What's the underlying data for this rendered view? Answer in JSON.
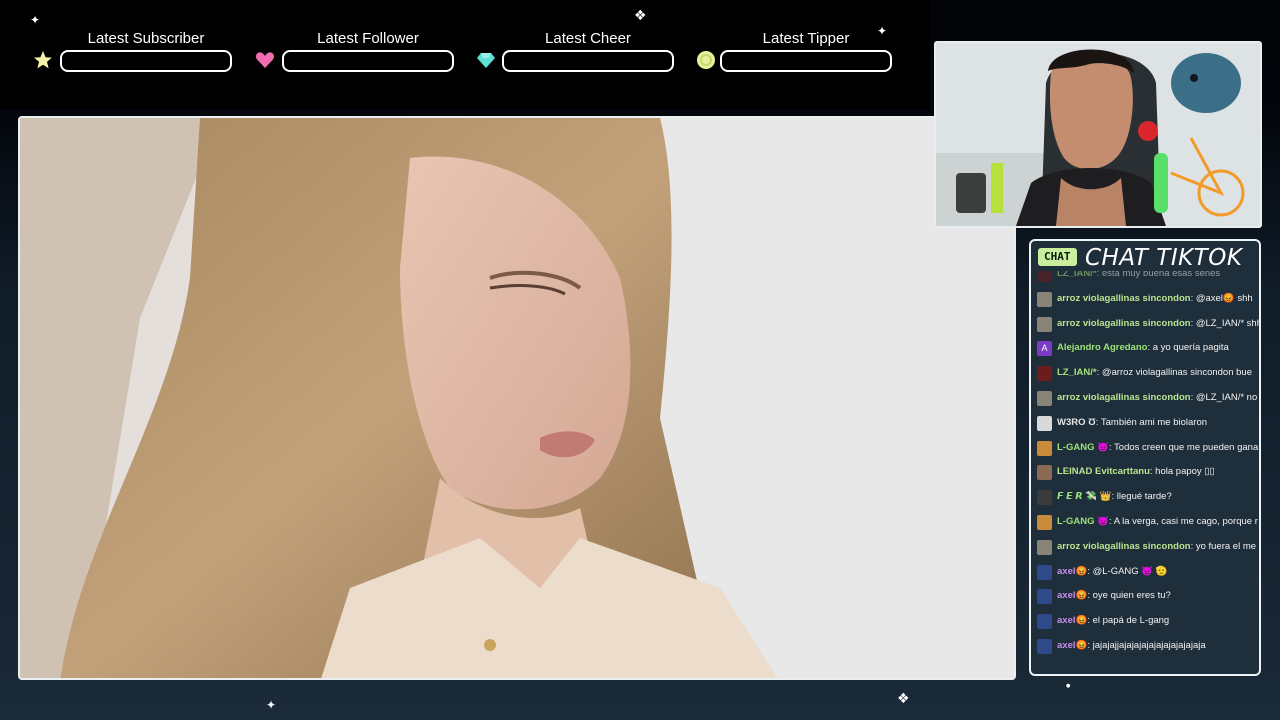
{
  "alerts": [
    {
      "label": "Latest Subscriber",
      "value": "",
      "icon": "star-icon",
      "color": "#f4f1a8"
    },
    {
      "label": "Latest Follower",
      "value": "",
      "icon": "heart-icon",
      "color": "#f06db0"
    },
    {
      "label": "Latest Cheer",
      "value": "",
      "icon": "gem-icon",
      "color": "#5fe0d6"
    },
    {
      "label": "Latest Tipper",
      "value": "",
      "icon": "coin-icon",
      "color": "#e8f19b"
    }
  ],
  "chat": {
    "badge": "CHAT",
    "title": "CHAT TIKTOK",
    "messages": [
      {
        "user": "LZ_IAN/*",
        "text": ": esta muy buena esas series",
        "user_color": "#a6e07a",
        "avatar": "red"
      },
      {
        "user": "arroz violagallinas sincondon",
        "text": ": @axel😡 shh",
        "user_color": "#b9e48f",
        "avatar": "grid"
      },
      {
        "user": "arroz violagallinas sincondon",
        "text": ": @LZ_IAN/* shh",
        "user_color": "#b9e48f",
        "avatar": "grid"
      },
      {
        "user": "Alejandro Agredano",
        "text": ": a yo quería pagita",
        "user_color": "#9be37a",
        "avatar": "letter-a"
      },
      {
        "user": "LZ_IAN/*",
        "text": ": @arroz violagallinas sincondon bue",
        "user_color": "#a6e07a",
        "avatar": "red"
      },
      {
        "user": "arroz violagallinas sincondon",
        "text": ": @LZ_IAN/* no p",
        "user_color": "#b9e48f",
        "avatar": "grid"
      },
      {
        "user": "W3RO Ʊ",
        "text": ": También ami me biolaron",
        "user_color": "#e6e6e6",
        "avatar": "white"
      },
      {
        "user": "L-GANG 😈",
        "text": ": Todos creen que me pueden gana",
        "user_color": "#9be37a",
        "avatar": "orange"
      },
      {
        "user": "LEINAD Evitcarttanu",
        "text": ": hola papoy ▯▯",
        "user_color": "#b9e48f",
        "avatar": "brown"
      },
      {
        "user": "𝙁 𝙀 𝙍 💸 👑",
        "text": ": llegué tarde?",
        "user_color": "#9be37a",
        "avatar": "dark"
      },
      {
        "user": "L-GANG 😈",
        "text": ": A la verga, casi me cago, porque r",
        "user_color": "#9be37a",
        "avatar": "orange"
      },
      {
        "user": "arroz violagallinas sincondon",
        "text": ": yo fuera el me l",
        "user_color": "#b9e48f",
        "avatar": "grid"
      },
      {
        "user": "axel😡",
        "text": ": @L-GANG 😈 🫡",
        "user_color": "#c98cf0",
        "avatar": "blue"
      },
      {
        "user": "axel😡",
        "text": ": oye quien eres tu?",
        "user_color": "#c98cf0",
        "avatar": "blue"
      },
      {
        "user": "axel😡",
        "text": ": el papá de L-gang",
        "user_color": "#c98cf0",
        "avatar": "blue"
      },
      {
        "user": "axel😡",
        "text": ": jajajajjajajajajajajajajajajaja",
        "user_color": "#c98cf0",
        "avatar": "blue"
      }
    ]
  },
  "colors": {
    "chat_badge": "#c9ef9c",
    "panel_bg": "#1e2e3b",
    "border": "#e9eef2"
  }
}
